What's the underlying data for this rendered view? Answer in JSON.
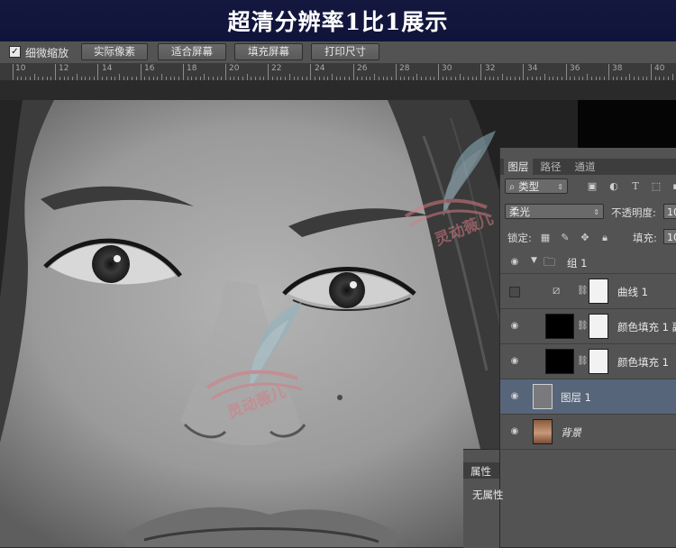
{
  "banner": {
    "title": "超清分辨率1比1展示"
  },
  "options_bar": {
    "scrubby_zoom": {
      "checked": true,
      "label": "细微缩放"
    },
    "buttons": [
      "实际像素",
      "适合屏幕",
      "填充屏幕",
      "打印尺寸"
    ]
  },
  "ruler": {
    "labels": [
      "10",
      "12",
      "14",
      "16",
      "18",
      "20",
      "22",
      "24",
      "26",
      "28",
      "30",
      "32",
      "34",
      "36",
      "38",
      "40"
    ]
  },
  "layers_panel": {
    "tabs": [
      "图层",
      "路径",
      "通道"
    ],
    "active_tab": "图层",
    "filter": {
      "kind": "类型",
      "icons": [
        "pixel-filter-icon",
        "adjustment-filter-icon",
        "type-filter-icon",
        "shape-filter-icon"
      ]
    },
    "blend_mode": "柔光",
    "opacity": {
      "label": "不透明度:",
      "value": "10"
    },
    "lock": {
      "label": "锁定:",
      "icons": [
        "lock-pixels-icon",
        "lock-paint-icon",
        "lock-position-icon",
        "lock-all-icon"
      ]
    },
    "fill": {
      "label": "填充:",
      "value": "10"
    },
    "layers": [
      {
        "name": "组 1",
        "type": "group",
        "visible": true,
        "expanded": true
      },
      {
        "name": "曲线 1",
        "type": "adjustment",
        "visible": false
      },
      {
        "name": "颜色填充 1 副",
        "type": "fill",
        "visible": true
      },
      {
        "name": "颜色填充 1",
        "type": "fill",
        "visible": true
      },
      {
        "name": "图层 1",
        "type": "pixel",
        "visible": true,
        "selected": true
      },
      {
        "name": "背景",
        "type": "background",
        "visible": true
      }
    ]
  },
  "properties_panel": {
    "tab": "属性",
    "text": "无属性"
  },
  "watermark": {
    "text": "灵动薇儿"
  },
  "colors": {
    "banner_bg": "#15183e",
    "panel_bg": "#535353",
    "selected_layer": "#56657a",
    "watermark": "#d67b84"
  }
}
